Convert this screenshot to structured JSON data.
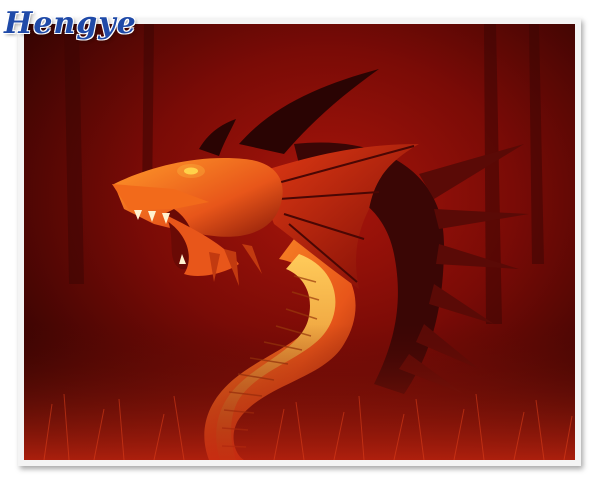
{
  "watermark": {
    "text": "Hengye",
    "colors": {
      "primary": "#1c3f95",
      "accent_red": "#c02626",
      "accent_green": "#2c8a3a"
    }
  },
  "image": {
    "subject": "red-dragon",
    "colors": {
      "background_dark": "#2a0302",
      "background_red": "#8e0d07",
      "dragon_orange": "#f26a1b",
      "dragon_belly": "#f6a93a",
      "dragon_dark": "#3a0605",
      "eye": "#ffd24a"
    }
  }
}
